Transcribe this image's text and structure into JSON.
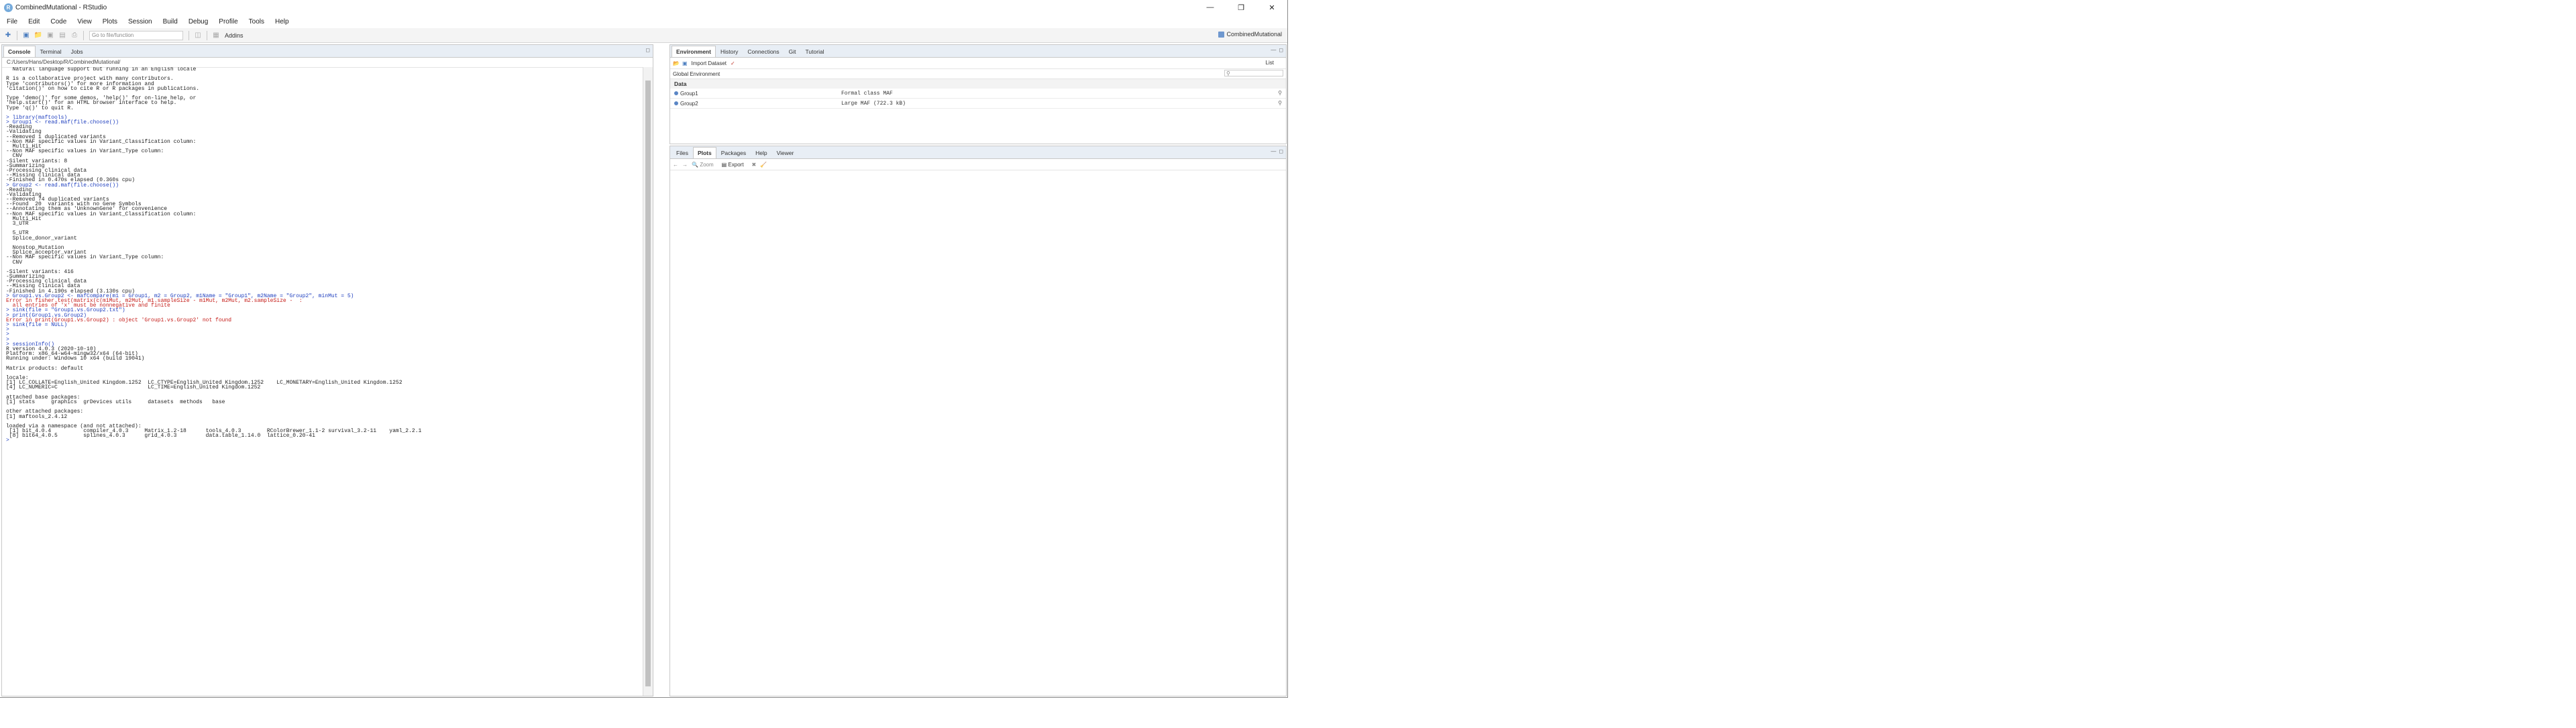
{
  "window": {
    "title": "CombinedMutational - RStudio",
    "controls": [
      "minimize",
      "maximize",
      "close"
    ]
  },
  "menu": [
    "File",
    "Edit",
    "Code",
    "View",
    "Plots",
    "Session",
    "Build",
    "Debug",
    "Profile",
    "Tools",
    "Help"
  ],
  "toolbar": {
    "goto_placeholder": "Go to file/function",
    "addins_label": "Addins",
    "project_name": "CombinedMutational"
  },
  "console_pane": {
    "tabs": [
      "Console",
      "Terminal",
      "Jobs"
    ],
    "active_tab": "Console",
    "path": "C:/Users/Hans/Desktop/R/CombinedMutational/",
    "lines": [
      {
        "t": "  Natural language support but running in an English locale",
        "k": "out"
      },
      {
        "t": "",
        "k": "out"
      },
      {
        "t": "R is a collaborative project with many contributors.",
        "k": "out"
      },
      {
        "t": "Type 'contributors()' for more information and",
        "k": "out"
      },
      {
        "t": "'citation()' on how to cite R or R packages in publications.",
        "k": "out"
      },
      {
        "t": "",
        "k": "out"
      },
      {
        "t": "Type 'demo()' for some demos, 'help()' for on-line help, or",
        "k": "out"
      },
      {
        "t": "'help.start()' for an HTML browser interface to help.",
        "k": "out"
      },
      {
        "t": "Type 'q()' to quit R.",
        "k": "out"
      },
      {
        "t": "",
        "k": "out"
      },
      {
        "t": "> library(maftools)",
        "k": "cmd"
      },
      {
        "t": "> Group1 <- read.maf(file.choose())",
        "k": "cmd"
      },
      {
        "t": "-Reading",
        "k": "out"
      },
      {
        "t": "-Validating",
        "k": "out"
      },
      {
        "t": "--Removed 1 duplicated variants",
        "k": "out"
      },
      {
        "t": "--Non MAF specific values in Variant_Classification column:",
        "k": "out"
      },
      {
        "t": "  Multi_Hit",
        "k": "out"
      },
      {
        "t": "--Non MAF specific values in Variant_Type column:",
        "k": "out"
      },
      {
        "t": "  CNV",
        "k": "out"
      },
      {
        "t": "-Silent variants: 8",
        "k": "out"
      },
      {
        "t": "-Summarizing",
        "k": "out"
      },
      {
        "t": "-Processing clinical data",
        "k": "out"
      },
      {
        "t": "--Missing clinical data",
        "k": "out"
      },
      {
        "t": "-Finished in 0.470s elapsed (0.360s cpu)",
        "k": "out"
      },
      {
        "t": "> Group2 <- read.maf(file.choose())",
        "k": "cmd"
      },
      {
        "t": "-Reading",
        "k": "out"
      },
      {
        "t": "-Validating",
        "k": "out"
      },
      {
        "t": "--Removed 74 duplicated variants",
        "k": "out"
      },
      {
        "t": "--Found  20  variants with no Gene Symbols",
        "k": "out"
      },
      {
        "t": "--Annotating them as 'UnknownGene' for convenience",
        "k": "out"
      },
      {
        "t": "--Non MAF specific values in Variant_Classification column:",
        "k": "out"
      },
      {
        "t": "  Multi_Hit",
        "k": "out"
      },
      {
        "t": "  3_UTR",
        "k": "out"
      },
      {
        "t": "",
        "k": "out"
      },
      {
        "t": "  5_UTR",
        "k": "out"
      },
      {
        "t": "  Splice_donor_variant",
        "k": "out"
      },
      {
        "t": "",
        "k": "out"
      },
      {
        "t": "  Nonstop_Mutation",
        "k": "out"
      },
      {
        "t": "  Splice_acceptor_variant",
        "k": "out"
      },
      {
        "t": "--Non MAF specific values in Variant_Type column:",
        "k": "out"
      },
      {
        "t": "  CNV",
        "k": "out"
      },
      {
        "t": "",
        "k": "out"
      },
      {
        "t": "-Silent variants: 416",
        "k": "out"
      },
      {
        "t": "-Summarizing",
        "k": "out"
      },
      {
        "t": "-Processing clinical data",
        "k": "out"
      },
      {
        "t": "--Missing clinical data",
        "k": "out"
      },
      {
        "t": "-Finished in 4.190s elapsed (3.130s cpu)",
        "k": "out"
      },
      {
        "t": "> Group1.vs.Group2 <- mafCompare(m1 = Group1, m2 = Group2, m1Name = \"Group1\", m2Name = \"Group2\", minMut = 5)",
        "k": "cmd"
      },
      {
        "t": "Error in fisher.test(matrix(c(m1Mut, m2Mut, m1.sampleSize - m1Mut, m2Mut, m2.sampleSize -  :",
        "k": "err"
      },
      {
        "t": "  all entries of 'x' must be nonnegative and finite",
        "k": "err"
      },
      {
        "t": "> sink(file = \"Group1.vs.Group2.txt\")",
        "k": "cmd"
      },
      {
        "t": "> print(Group1.vs.Group2)",
        "k": "cmd"
      },
      {
        "t": "Error in print(Group1.vs.Group2) : object 'Group1.vs.Group2' not found",
        "k": "err"
      },
      {
        "t": "> sink(file = NULL)",
        "k": "cmd"
      },
      {
        "t": ">",
        "k": "cmd"
      },
      {
        "t": ">",
        "k": "cmd"
      },
      {
        "t": ">",
        "k": "cmd"
      },
      {
        "t": "> sessionInfo()",
        "k": "cmd"
      },
      {
        "t": "R version 4.0.3 (2020-10-10)",
        "k": "out"
      },
      {
        "t": "Platform: x86_64-w64-mingw32/x64 (64-bit)",
        "k": "out"
      },
      {
        "t": "Running under: Windows 10 x64 (build 19041)",
        "k": "out"
      },
      {
        "t": "",
        "k": "out"
      },
      {
        "t": "Matrix products: default",
        "k": "out"
      },
      {
        "t": "",
        "k": "out"
      },
      {
        "t": "locale:",
        "k": "out"
      },
      {
        "t": "[1] LC_COLLATE=English_United Kingdom.1252  LC_CTYPE=English_United Kingdom.1252    LC_MONETARY=English_United Kingdom.1252",
        "k": "out"
      },
      {
        "t": "[4] LC_NUMERIC=C                            LC_TIME=English_United Kingdom.1252",
        "k": "out"
      },
      {
        "t": "",
        "k": "out"
      },
      {
        "t": "attached base packages:",
        "k": "out"
      },
      {
        "t": "[1] stats     graphics  grDevices utils     datasets  methods   base",
        "k": "out"
      },
      {
        "t": "",
        "k": "out"
      },
      {
        "t": "other attached packages:",
        "k": "out"
      },
      {
        "t": "[1] maftools_2.4.12",
        "k": "out"
      },
      {
        "t": "",
        "k": "out"
      },
      {
        "t": "loaded via a namespace (and not attached):",
        "k": "out"
      },
      {
        "t": " [1] bit_4.0.4          compiler_4.0.3     Matrix_1.2-18      tools_4.0.3        RColorBrewer_1.1-2 survival_3.2-11    yaml_2.2.1",
        "k": "out"
      },
      {
        "t": " [8] bit64_4.0.5        splines_4.0.3      grid_4.0.3         data.table_1.14.0  lattice_0.20-41",
        "k": "out"
      },
      {
        "t": ">",
        "k": "cmd"
      }
    ]
  },
  "environment_pane": {
    "tabs": [
      "Environment",
      "History",
      "Connections",
      "Git",
      "Tutorial"
    ],
    "active_tab": "Environment",
    "import_label": "Import Dataset",
    "list_label": "List",
    "scope_label": "Global Environment",
    "section_header": "Data",
    "rows": [
      {
        "name": "Group1",
        "value": "Formal class MAF"
      },
      {
        "name": "Group2",
        "value": "Large MAF (722.3 kB)"
      }
    ]
  },
  "files_pane": {
    "tabs": [
      "Files",
      "Plots",
      "Packages",
      "Help",
      "Viewer"
    ],
    "active_tab": "Plots",
    "zoom_label": "Zoom",
    "export_label": "Export"
  }
}
